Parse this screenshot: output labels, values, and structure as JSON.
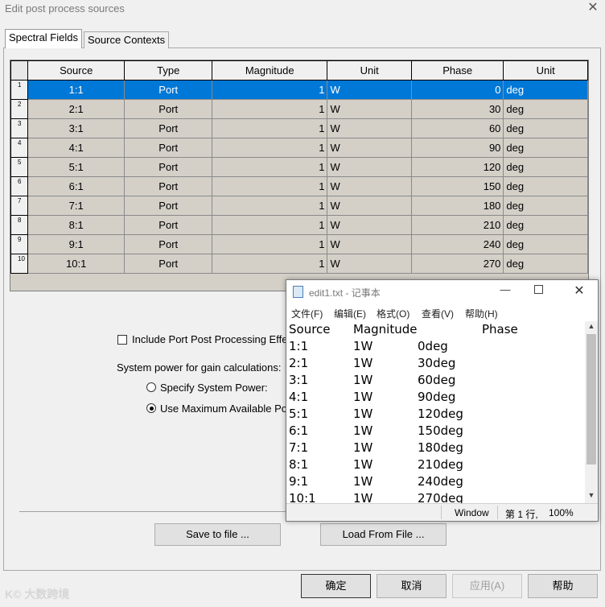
{
  "dialog": {
    "title": "Edit post process sources",
    "tabs": [
      "Spectral Fields",
      "Source Contexts"
    ],
    "grid": {
      "columns": [
        "Source",
        "Type",
        "Magnitude",
        "Unit",
        "Phase",
        "Unit"
      ],
      "rows": [
        {
          "num": "1",
          "source": "1:1",
          "type": "Port",
          "magnitude": "1",
          "munit": "W",
          "phase": "0",
          "punit": "deg",
          "selected": true
        },
        {
          "num": "2",
          "source": "2:1",
          "type": "Port",
          "magnitude": "1",
          "munit": "W",
          "phase": "30",
          "punit": "deg"
        },
        {
          "num": "3",
          "source": "3:1",
          "type": "Port",
          "magnitude": "1",
          "munit": "W",
          "phase": "60",
          "punit": "deg"
        },
        {
          "num": "4",
          "source": "4:1",
          "type": "Port",
          "magnitude": "1",
          "munit": "W",
          "phase": "90",
          "punit": "deg"
        },
        {
          "num": "5",
          "source": "5:1",
          "type": "Port",
          "magnitude": "1",
          "munit": "W",
          "phase": "120",
          "punit": "deg"
        },
        {
          "num": "6",
          "source": "6:1",
          "type": "Port",
          "magnitude": "1",
          "munit": "W",
          "phase": "150",
          "punit": "deg"
        },
        {
          "num": "7",
          "source": "7:1",
          "type": "Port",
          "magnitude": "1",
          "munit": "W",
          "phase": "180",
          "punit": "deg"
        },
        {
          "num": "8",
          "source": "8:1",
          "type": "Port",
          "magnitude": "1",
          "munit": "W",
          "phase": "210",
          "punit": "deg"
        },
        {
          "num": "9",
          "source": "9:1",
          "type": "Port",
          "magnitude": "1",
          "munit": "W",
          "phase": "240",
          "punit": "deg"
        },
        {
          "num": "10",
          "source": "10:1",
          "type": "Port",
          "magnitude": "1",
          "munit": "W",
          "phase": "270",
          "punit": "deg"
        }
      ]
    },
    "include_port_label": "Include Port Post Processing Effe",
    "system_power_label": "System power for gain calculations:",
    "specify_power_label": "Specify System Power:",
    "use_max_label": "Use Maximum Available Po",
    "save_label": "Save to file ...",
    "load_label": "Load From File ...",
    "ok_label": "确定",
    "cancel_label": "取消",
    "apply_label": "应用(A)",
    "help_label": "帮助",
    "watermark": "K© 大数跨境"
  },
  "notepad": {
    "title": "edit1.txt - 记事本",
    "menus": [
      "文件(F)",
      "编辑(E)",
      "格式(O)",
      "查看(V)",
      "帮助(H)"
    ],
    "header": {
      "source": "Source",
      "magnitude": "Magnitude",
      "phase": "Phase"
    },
    "lines": [
      {
        "source": "1:1",
        "mag": "1W",
        "phase": "0deg"
      },
      {
        "source": "2:1",
        "mag": "1W",
        "phase": "30deg"
      },
      {
        "source": "3:1",
        "mag": "1W",
        "phase": "60deg"
      },
      {
        "source": "4:1",
        "mag": "1W",
        "phase": "90deg"
      },
      {
        "source": "5:1",
        "mag": "1W",
        "phase": "120deg"
      },
      {
        "source": "6:1",
        "mag": "1W",
        "phase": "150deg"
      },
      {
        "source": "7:1",
        "mag": "1W",
        "phase": "180deg"
      },
      {
        "source": "8:1",
        "mag": "1W",
        "phase": "210deg"
      },
      {
        "source": "9:1",
        "mag": "1W",
        "phase": "240deg"
      },
      {
        "source": "10:1",
        "mag": "1W",
        "phase": "270deg"
      }
    ],
    "status": {
      "eol": "Window",
      "position": "第 1 行,",
      "zoom": "100%"
    }
  }
}
